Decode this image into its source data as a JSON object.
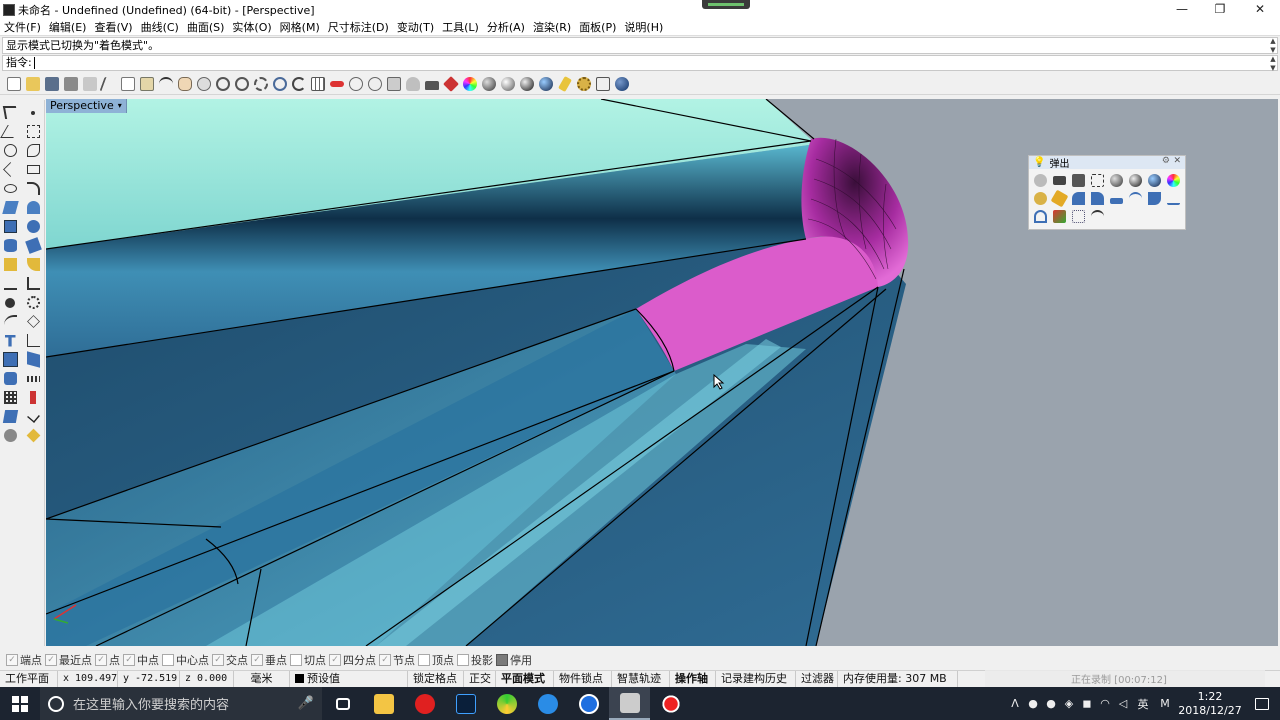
{
  "window": {
    "title": "未命名 - Undefined (Undefined) (64-bit) - [Perspective]",
    "controls": {
      "minimize": "—",
      "maximize": "❐",
      "close": "✕"
    }
  },
  "menu": [
    "文件(F)",
    "编辑(E)",
    "查看(V)",
    "曲线(C)",
    "曲面(S)",
    "实体(O)",
    "网格(M)",
    "尺寸标注(D)",
    "变动(T)",
    "工具(L)",
    "分析(A)",
    "渲染(R)",
    "面板(P)",
    "说明(H)"
  ],
  "command": {
    "history": "显示模式已切换为\"着色模式\"。",
    "prompt": "指令:"
  },
  "viewport": {
    "tab_label": "Perspective",
    "tab_arrow": "▾",
    "colors": {
      "surface_light": "#aef0e0",
      "surface_dark": "#2a5f86",
      "highlight": "#d957c8",
      "background": "#9aa3ad"
    }
  },
  "popup": {
    "title": "弹出",
    "gear": "⚙",
    "close": "✕"
  },
  "osnaps": [
    {
      "label": "端点",
      "checked": true
    },
    {
      "label": "最近点",
      "checked": true
    },
    {
      "label": "点",
      "checked": true
    },
    {
      "label": "中点",
      "checked": true
    },
    {
      "label": "中心点",
      "checked": false
    },
    {
      "label": "交点",
      "checked": true
    },
    {
      "label": "垂点",
      "checked": true
    },
    {
      "label": "切点",
      "checked": false
    },
    {
      "label": "四分点",
      "checked": true
    },
    {
      "label": "节点",
      "checked": true
    },
    {
      "label": "顶点",
      "checked": false
    },
    {
      "label": "投影",
      "checked": false
    },
    {
      "label": "停用",
      "checked": true
    }
  ],
  "status": {
    "cplane": "工作平面",
    "x": "x 109.497",
    "y": "y -72.519",
    "z": "z 0.000",
    "units": "毫米",
    "layer": "预设值",
    "grid_snap": "锁定格点",
    "ortho": "正交",
    "planar": "平面模式",
    "osnap": "物件锁点",
    "smarttrack": "智慧轨迹",
    "gumball": "操作轴",
    "history": "记录建构历史",
    "filter": "过滤器",
    "memory": "内存使用量: 307 MB",
    "recording": "正在录制 [00:07:12]"
  },
  "taskbar": {
    "search_placeholder": "在这里输入你要搜索的内容",
    "time": "1:22",
    "date": "2018/12/27",
    "ime": "英",
    "ime2": "M"
  }
}
